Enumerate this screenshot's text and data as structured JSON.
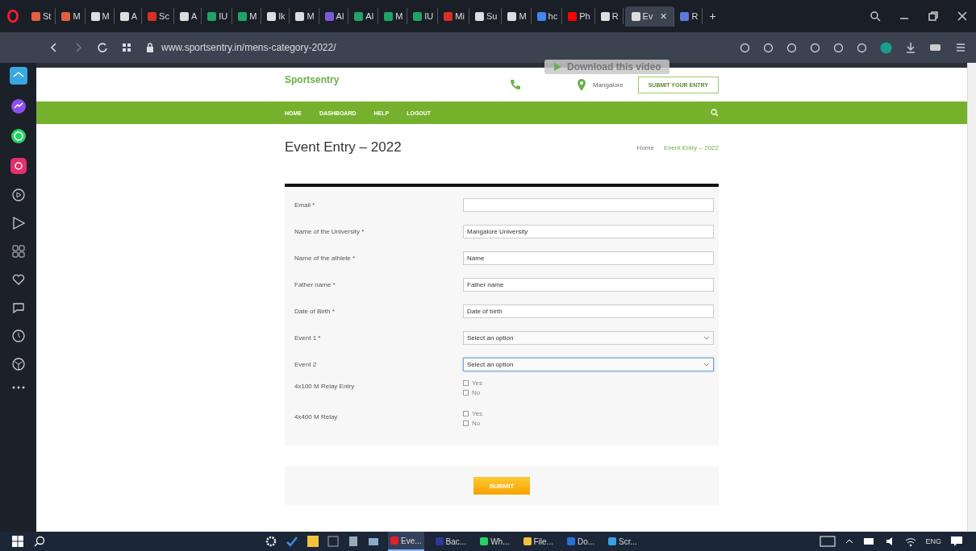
{
  "browser": {
    "tabs": [
      {
        "label": "St",
        "selected": false,
        "color": "#e06040"
      },
      {
        "label": "M",
        "selected": false,
        "color": "#e06040"
      },
      {
        "label": "M",
        "selected": false,
        "color": "#dddddd"
      },
      {
        "label": "A",
        "selected": false,
        "color": "#dddddd"
      },
      {
        "label": "Sc",
        "selected": false,
        "color": "#d93025"
      },
      {
        "label": "A",
        "selected": false,
        "color": "#dddddd"
      },
      {
        "label": "IU",
        "selected": false,
        "color": "#1fa463"
      },
      {
        "label": "M",
        "selected": false,
        "color": "#1fa463"
      },
      {
        "label": "lk",
        "selected": false,
        "color": "#dddddd"
      },
      {
        "label": "M",
        "selected": false,
        "color": "#dddddd"
      },
      {
        "label": "Al",
        "selected": false,
        "color": "#7b5ad6"
      },
      {
        "label": "Al",
        "selected": false,
        "color": "#1fa463"
      },
      {
        "label": "M",
        "selected": false,
        "color": "#1fa463"
      },
      {
        "label": "IU",
        "selected": false,
        "color": "#1fa463"
      },
      {
        "label": "Mi",
        "selected": false,
        "color": "#d93025"
      },
      {
        "label": "Su",
        "selected": false,
        "color": "#dddddd"
      },
      {
        "label": "M",
        "selected": false,
        "color": "#dddddd"
      },
      {
        "label": "hc",
        "selected": false,
        "color": "#4285f4"
      },
      {
        "label": "Ph",
        "selected": false,
        "color": "#ff0000"
      },
      {
        "label": "R",
        "selected": false,
        "color": "#dddddd"
      },
      {
        "label": "Ev",
        "selected": true,
        "color": "#dddddd",
        "close": "✕"
      },
      {
        "label": "R",
        "selected": false,
        "color": "#5b7be0"
      }
    ],
    "new_tab": "+",
    "url": "www.sportsentry.in/mens-category-2022/",
    "download_popup": "Download this video"
  },
  "site": {
    "logo": "Sportsentry",
    "location": "Mangalore",
    "cta": "SUBMIT YOUR ENTRY",
    "nav": [
      "HOME",
      "DASHBOARD",
      "HELP",
      "LOGOUT"
    ]
  },
  "page": {
    "title": "Event Entry – 2022",
    "breadcrumb": [
      "Home",
      "Event Entry – 2022"
    ]
  },
  "form": {
    "fields": [
      {
        "kind": "text",
        "label": "Email *"
      },
      {
        "kind": "text",
        "label": "Name of the University *",
        "value": "Mangalore University"
      },
      {
        "kind": "text",
        "label": "Name of the athlete *",
        "value": "Name"
      },
      {
        "kind": "text",
        "label": "Father name *",
        "value": "Father name"
      },
      {
        "kind": "text",
        "label": "Date of Birth *",
        "value": "Date of birth"
      },
      {
        "kind": "select",
        "label": "Event 1 *",
        "value": "Select an option",
        "focused": false
      },
      {
        "kind": "select",
        "label": "Event 2",
        "value": "Select an option",
        "focused": true
      },
      {
        "kind": "checks",
        "label": "4x100 M Relay Entry",
        "options": [
          {
            "label": "Yes",
            "checked": false
          },
          {
            "label": "No",
            "checked": false
          }
        ]
      },
      {
        "kind": "checks",
        "label": "4x400 M Relay",
        "options": [
          {
            "label": "Yes",
            "checked": false
          },
          {
            "label": "No",
            "checked": false
          }
        ]
      }
    ],
    "submit": "SUBMIT"
  },
  "taskbar": {
    "apps": [
      {
        "label": "Eve...",
        "color": "#e0202a",
        "selected": true
      },
      {
        "label": "Bac...",
        "color": "#2a3b9a",
        "selected": false
      },
      {
        "label": "Wh...",
        "color": "#25d366",
        "selected": false
      },
      {
        "label": "File...",
        "color": "#f3c23c",
        "selected": false
      },
      {
        "label": "Do...",
        "color": "#2b6fd6",
        "selected": false
      },
      {
        "label": "Scr...",
        "color": "#3aa0e0",
        "selected": false
      }
    ],
    "language": "ENG"
  }
}
